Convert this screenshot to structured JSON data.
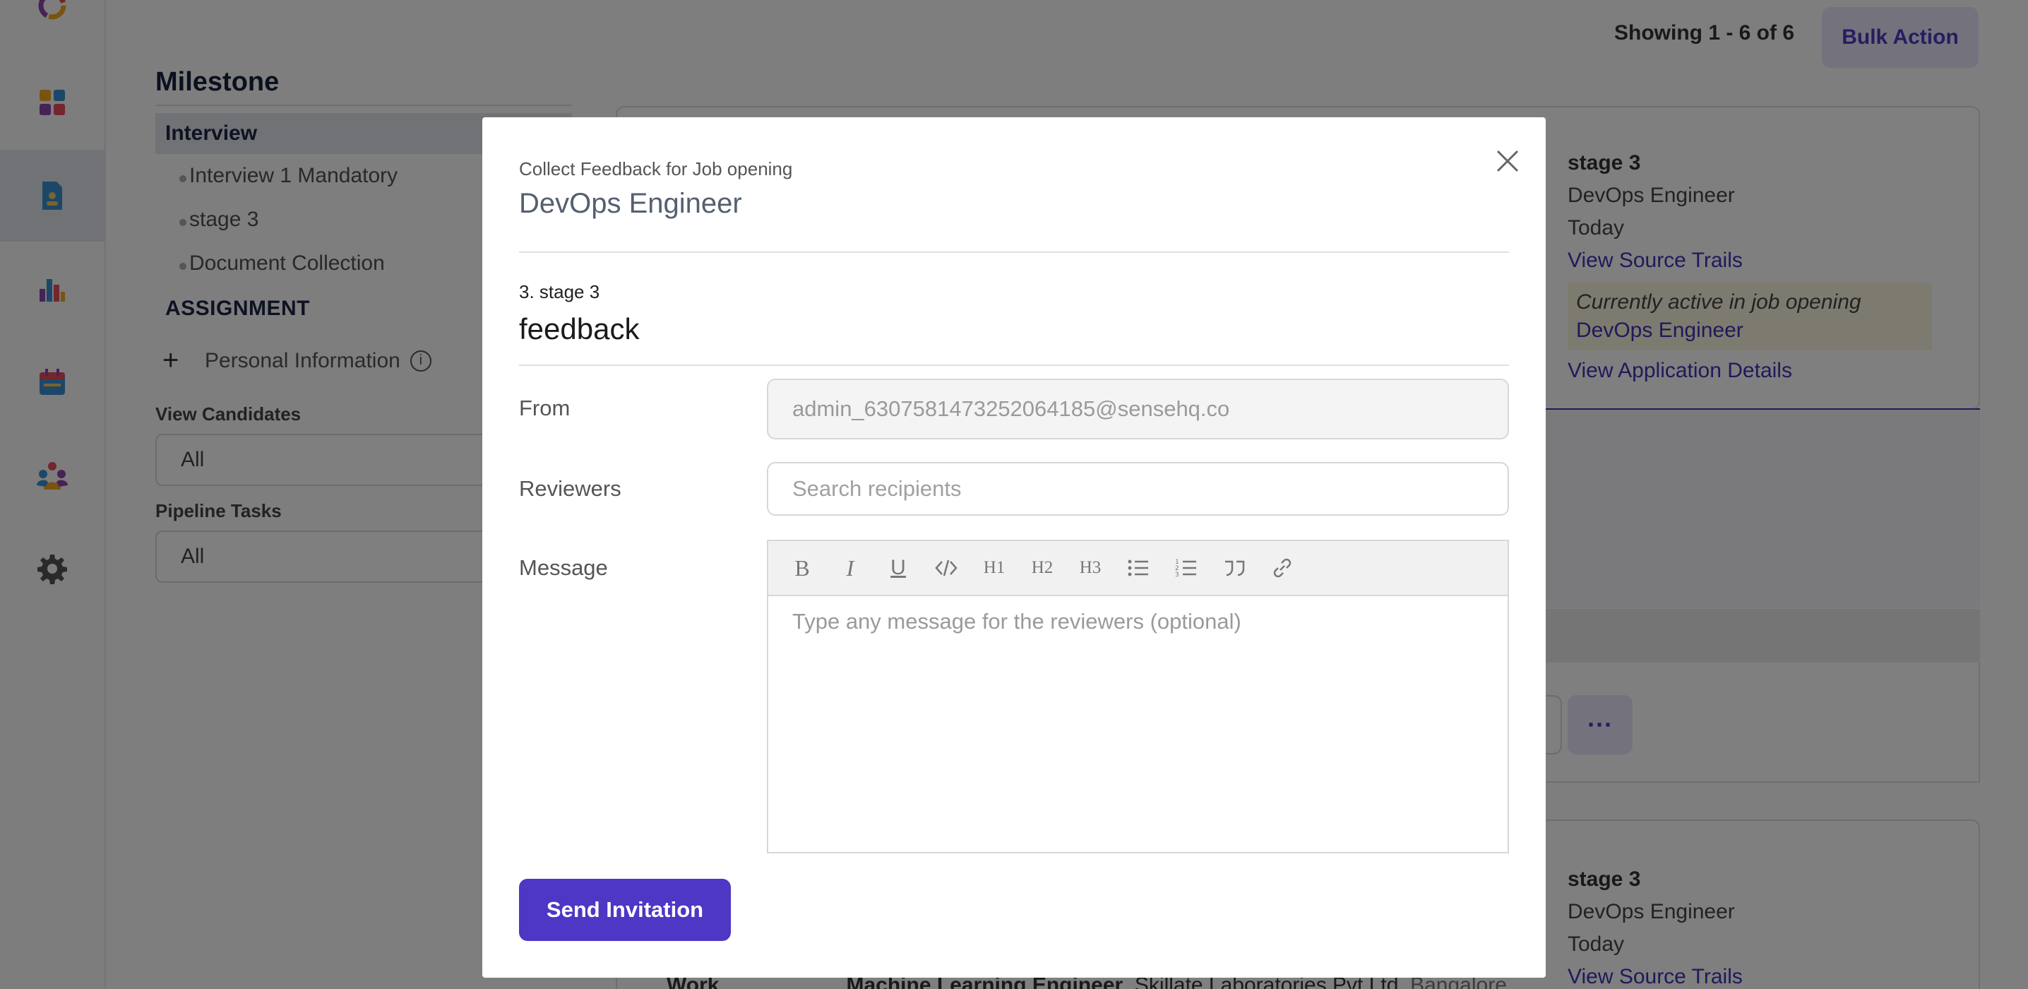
{
  "colors": {
    "accent": "#4d37c4",
    "link": "#3f34b5",
    "overlay": "rgba(0,0,0,0.5)"
  },
  "sidebar": {
    "icons": [
      "logo-ring-icon",
      "dashboard-grid-icon",
      "document-icon",
      "bar-chart-icon",
      "calendar-icon",
      "team-icon",
      "gear-icon"
    ]
  },
  "topbar": {
    "count_text": "Showing 1 - 6 of 6",
    "bulk_action_label": "Bulk Action"
  },
  "filters": {
    "milestone_title": "Milestone",
    "section_interview": "Interview",
    "milestone_items": [
      "Interview 1 Mandatory",
      "stage 3",
      "Document Collection"
    ],
    "assignment_label": "ASSIGNMENT",
    "personal_info_label": "Personal Information",
    "view_candidates_label": "View Candidates",
    "view_candidates_value": "All",
    "pipeline_tasks_label": "Pipeline Tasks",
    "pipeline_tasks_value": "All"
  },
  "card1": {
    "stage": "stage 3",
    "job": "DevOps Engineer",
    "date": "Today",
    "source_link": "View Source Trails",
    "active_prefix": "Currently active in job opening",
    "active_job": "DevOps Engineer",
    "app_details_link": "View Application Details"
  },
  "card2": {
    "stage": "stage 3",
    "job": "DevOps Engineer",
    "date": "Today",
    "source_link": "View Source Trails",
    "work_label": "Work",
    "work_title": "Machine Learning Engineer",
    "work_company": ", Skillate Laboratories Pvt Ltd",
    "work_city": ", Bangalore"
  },
  "more_button_label": "···",
  "modal": {
    "subtitle": "Collect Feedback for Job opening",
    "title": "DevOps Engineer",
    "stage_label": "3. stage 3",
    "feedback_label": "feedback",
    "from_label": "From",
    "from_value": "admin_6307581473252064185@sensehq.co",
    "reviewers_label": "Reviewers",
    "reviewers_placeholder": "Search recipients",
    "message_label": "Message",
    "message_placeholder": "Type any message for the reviewers (optional)",
    "toolbar": {
      "bold": "B",
      "italic": "I",
      "underline": "U",
      "h1": "H1",
      "h2": "H2",
      "h3": "H3"
    },
    "send_label": "Send Invitation"
  }
}
